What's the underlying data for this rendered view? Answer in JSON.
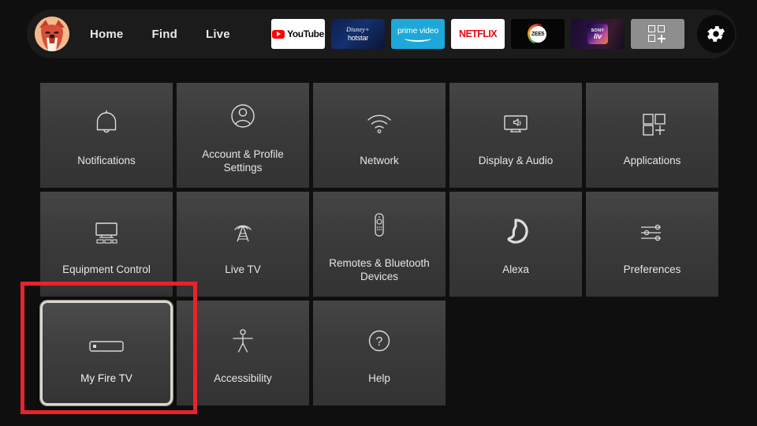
{
  "header": {
    "avatar": {
      "name": "user-avatar",
      "alt": "profile picture"
    },
    "nav": [
      {
        "label": "Home",
        "name": "nav-home"
      },
      {
        "label": "Find",
        "name": "nav-find"
      },
      {
        "label": "Live",
        "name": "nav-live"
      }
    ],
    "apps": [
      {
        "name": "app-youtube",
        "label": "YouTube"
      },
      {
        "name": "app-disney-hotstar",
        "label": "Disney+ hotstar",
        "line1": "Disney+",
        "line2": "hotstar"
      },
      {
        "name": "app-prime-video",
        "label": "prime video",
        "line1": "prime video"
      },
      {
        "name": "app-netflix",
        "label": "NETFLIX"
      },
      {
        "name": "app-zee5",
        "label": "ZEE5"
      },
      {
        "name": "app-sony-liv",
        "label": "SONY LIV",
        "line1": "SONY",
        "line2": "liv"
      },
      {
        "name": "app-grid-all-apps",
        "label": "All Apps"
      }
    ],
    "settings_button": {
      "label": "Settings",
      "name": "settings-gear"
    }
  },
  "grid": {
    "tiles": [
      {
        "label": "Notifications",
        "icon": "bell-icon",
        "focused": false
      },
      {
        "label": "Account & Profile Settings",
        "icon": "person-circle-icon",
        "focused": false
      },
      {
        "label": "Network",
        "icon": "wifi-icon",
        "focused": false
      },
      {
        "label": "Display & Audio",
        "icon": "tv-speaker-icon",
        "focused": false
      },
      {
        "label": "Applications",
        "icon": "apps-grid-plus-icon",
        "focused": false
      },
      {
        "label": "Equipment Control",
        "icon": "tv-equipment-icon",
        "focused": false
      },
      {
        "label": "Live TV",
        "icon": "antenna-tower-icon",
        "focused": false
      },
      {
        "label": "Remotes & Bluetooth Devices",
        "icon": "remote-control-icon",
        "focused": false
      },
      {
        "label": "Alexa",
        "icon": "alexa-ring-icon",
        "focused": false
      },
      {
        "label": "Preferences",
        "icon": "sliders-icon",
        "focused": false
      },
      {
        "label": "My Fire TV",
        "icon": "fire-tv-stick-icon",
        "focused": true
      },
      {
        "label": "Accessibility",
        "icon": "accessibility-person-icon",
        "focused": false
      },
      {
        "label": "Help",
        "icon": "question-circle-icon",
        "focused": false
      }
    ]
  },
  "annotation": {
    "name": "red-highlight-box",
    "color": "#e8232a",
    "targets": "My Fire TV"
  },
  "colors": {
    "page_background": "#0f0f0f",
    "header_background": "#1b1b1b",
    "tile_background": "#3b3b3b",
    "focus_border": "#dcd7cb",
    "text": "#e6e6e6",
    "annotation_red": "#e8232a"
  }
}
